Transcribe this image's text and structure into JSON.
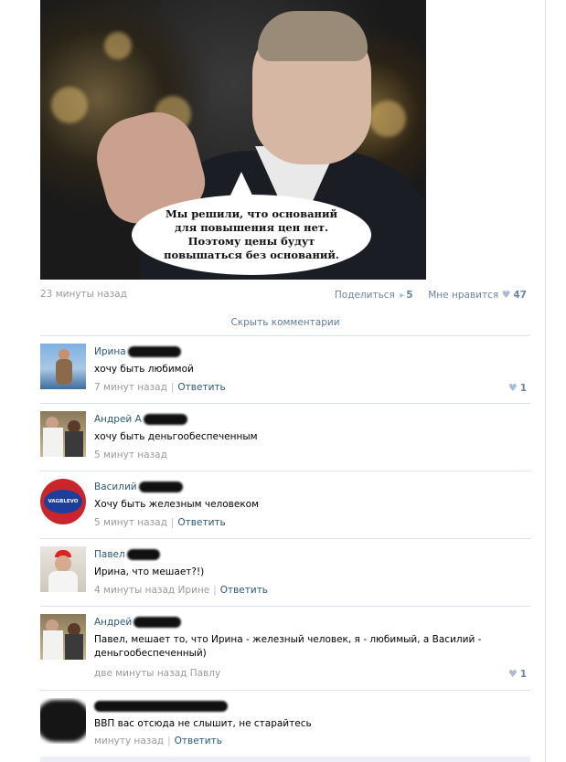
{
  "post": {
    "image_caption": "Мы решили, что оснований\nдля повышения цен нет.\nПоэтому цены будут\nповышаться без оснований.",
    "time": "23 минуты назад",
    "share_label": "Поделиться",
    "share_count": "5",
    "like_label": "Мне нравится",
    "like_count": "47"
  },
  "hide_comments_label": "Скрыть комментарии",
  "comments": [
    {
      "name": "Ирина",
      "text": "хочу быть любимой",
      "time": "7 минут назад",
      "reply": "Ответить",
      "likes": "1"
    },
    {
      "name": "Андрей А",
      "text": "хочу быть деньгообеспеченным",
      "time": "5 минут назад"
    },
    {
      "name": "Василий",
      "text": "Хочу быть железным человеком",
      "time": "5 минут назад",
      "reply": "Ответить",
      "avatar_text": "VAGBLEVO"
    },
    {
      "name": "Павел",
      "text": "Ирина, что мешает?!)",
      "time": "4 минуты назад Ирине",
      "reply": "Ответить"
    },
    {
      "name": "Андрей",
      "text": "Павел, мешает то, что Ирина - железный человек, я - любимый, а Василий - деньгообеспеченный)",
      "time": "две минуты назад Павлу",
      "likes": "1"
    },
    {
      "name": "",
      "text": "ВВП вас отсюда не слышит, не старайтесь",
      "time": "минуту назад",
      "reply": "Ответить"
    }
  ],
  "colors": {
    "link": "#2b587a",
    "meta_link": "#6b84a3",
    "gray": "#999999",
    "separator": "#dae1e8"
  }
}
